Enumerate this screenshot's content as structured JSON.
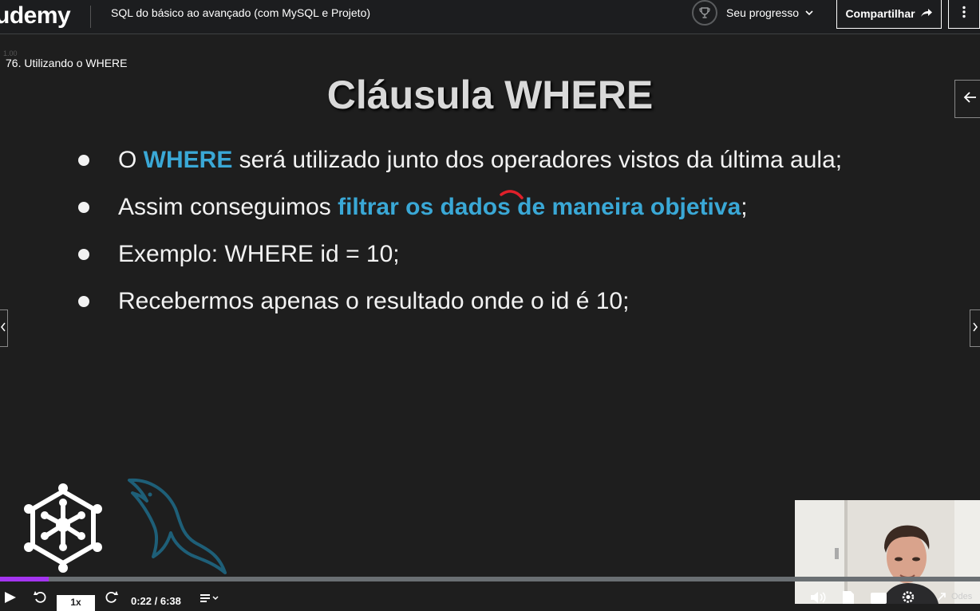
{
  "header": {
    "logo_text": "udemy",
    "course_title": "SQL do básico ao avançado (com MySQL e Projeto)",
    "progress_label": "Seu progresso",
    "share_label": "Compartilhar"
  },
  "lecture": {
    "ghost_number": "1.00",
    "title": "76. Utilizando o WHERE"
  },
  "slide": {
    "title": "Cláusula WHERE",
    "bullets": [
      {
        "before": "O ",
        "highlight": "WHERE",
        "after": " será utilizado junto dos operadores vistos da última aula;"
      },
      {
        "before": "Assim conseguimos ",
        "highlight": "filtrar os dados de maneira objetiva",
        "after": ";"
      },
      {
        "before": "Exemplo: WHERE id = 10;",
        "highlight": "",
        "after": ""
      },
      {
        "before": "Recebermos apenas o resultado onde o id é 10;",
        "highlight": "",
        "after": ""
      }
    ]
  },
  "player": {
    "speed": "1x",
    "time": "0:22 / 6:38",
    "progress_fraction": 0.05,
    "cam_label": "Odes"
  },
  "colors": {
    "accent_purple": "#a435f0",
    "highlight_blue": "#3aa8d6",
    "background": "#1e1e1e",
    "topbar": "#1c1d1f"
  },
  "icons": [
    "trophy-icon",
    "chevron-down-icon",
    "share-arrow-icon",
    "more-vertical-icon",
    "arrow-left-icon",
    "play-icon",
    "rewind-icon",
    "forward-icon",
    "transcript-icon",
    "volume-icon",
    "notes-icon",
    "captions-icon",
    "settings-icon",
    "fullscreen-icon"
  ]
}
